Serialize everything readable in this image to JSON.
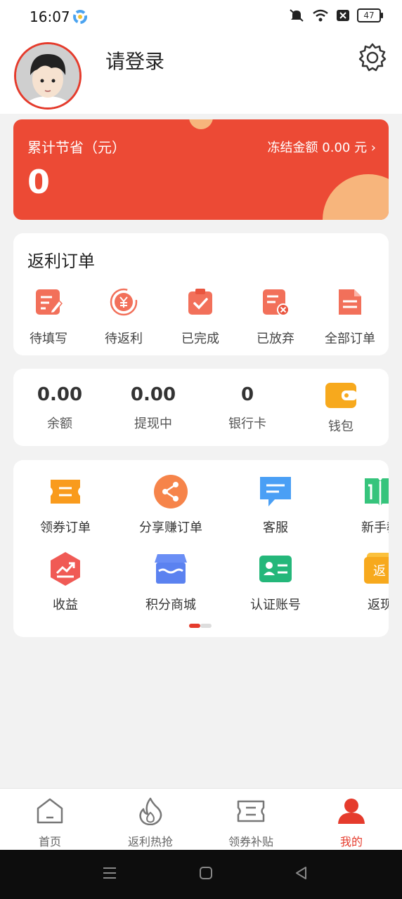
{
  "status_bar": {
    "time": "16:07",
    "battery": "47"
  },
  "header": {
    "login_text": "请登录"
  },
  "savings": {
    "label": "累计节省（元）",
    "amount": "0",
    "frozen_label": "冻结金额 0.00 元 ›"
  },
  "orders": {
    "title": "返利订单",
    "items": [
      {
        "label": "待填写",
        "icon": "edit-doc-icon"
      },
      {
        "label": "待返利",
        "icon": "yuan-circle-icon"
      },
      {
        "label": "已完成",
        "icon": "clipboard-check-icon"
      },
      {
        "label": "已放弃",
        "icon": "doc-cancel-icon"
      },
      {
        "label": "全部订单",
        "icon": "doc-list-icon"
      }
    ]
  },
  "wallet": {
    "stats": [
      {
        "value": "0.00",
        "label": "余额"
      },
      {
        "value": "0.00",
        "label": "提现中"
      },
      {
        "value": "0",
        "label": "银行卡"
      }
    ],
    "wallet_label": "钱包"
  },
  "services": {
    "row1": [
      {
        "label": "领券订单",
        "icon": "coupon-icon"
      },
      {
        "label": "分享赚订单",
        "icon": "share-icon"
      },
      {
        "label": "客服",
        "icon": "chat-icon"
      },
      {
        "label": "新手教",
        "icon": "book-icon"
      }
    ],
    "row2": [
      {
        "label": "收益",
        "icon": "earnings-icon"
      },
      {
        "label": "积分商城",
        "icon": "shop-icon"
      },
      {
        "label": "认证账号",
        "icon": "id-card-icon"
      },
      {
        "label": "返现",
        "icon": "cashback-icon"
      }
    ]
  },
  "tabbar": {
    "tabs": [
      {
        "label": "首页",
        "icon": "home-icon"
      },
      {
        "label": "返利热抢",
        "icon": "flame-icon"
      },
      {
        "label": "领券补贴",
        "icon": "ticket-icon"
      },
      {
        "label": "我的",
        "icon": "user-icon"
      }
    ],
    "active_index": 3
  },
  "colors": {
    "accent": "#e53b2c",
    "card_bg": "#ec4a35",
    "deco": "#f7b57c"
  }
}
